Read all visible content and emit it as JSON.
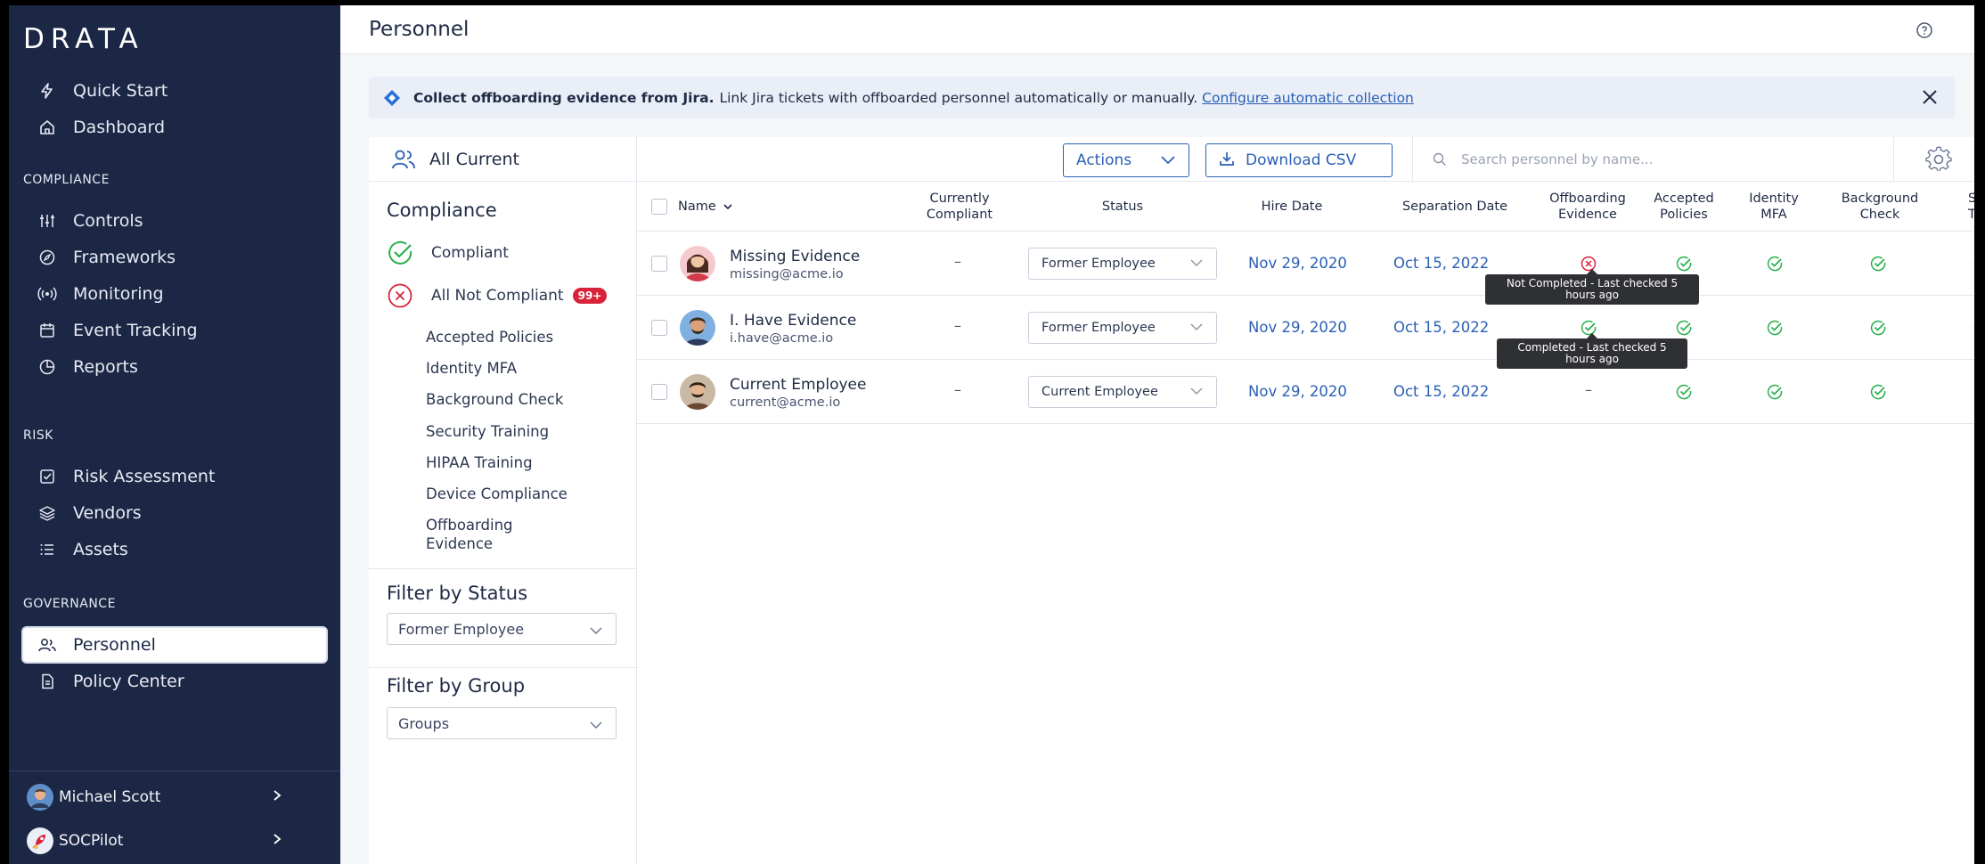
{
  "app": {
    "logo": "DRATA"
  },
  "sidebar": {
    "top_items": [
      {
        "label": "Quick Start",
        "icon": "bolt-icon"
      },
      {
        "label": "Dashboard",
        "icon": "home-icon"
      }
    ],
    "compliance_label": "COMPLIANCE",
    "compliance_items": [
      {
        "label": "Controls",
        "icon": "sliders-icon"
      },
      {
        "label": "Frameworks",
        "icon": "compass-icon"
      },
      {
        "label": "Monitoring",
        "icon": "broadcast-icon"
      },
      {
        "label": "Event Tracking",
        "icon": "calendar-icon"
      },
      {
        "label": "Reports",
        "icon": "pie-chart-icon"
      }
    ],
    "risk_label": "RISK",
    "risk_items": [
      {
        "label": "Risk Assessment",
        "icon": "checkbox-icon"
      },
      {
        "label": "Vendors",
        "icon": "layers-icon"
      },
      {
        "label": "Assets",
        "icon": "list-icon"
      }
    ],
    "governance_label": "GOVERNANCE",
    "governance_items": [
      {
        "label": "Personnel",
        "icon": "people-icon",
        "active": true
      },
      {
        "label": "Policy Center",
        "icon": "document-icon"
      }
    ],
    "user": {
      "name": "Michael Scott"
    },
    "org": {
      "name": "SOCPilot"
    }
  },
  "header": {
    "title": "Personnel"
  },
  "banner": {
    "bold": "Collect offboarding evidence from Jira.",
    "text": "Link Jira tickets with offboarded personnel automatically or manually.",
    "link": "Configure automatic collection"
  },
  "filters": {
    "all_current": "All Current",
    "compliance_title": "Compliance",
    "compliant": "Compliant",
    "not_compliant": "All Not Compliant",
    "not_compliant_badge": "99+",
    "sub_items": [
      "Accepted Policies",
      "Identity MFA",
      "Background Check",
      "Security Training",
      "HIPAA Training",
      "Device Compliance",
      "Offboarding Evidence"
    ],
    "status_title": "Filter by Status",
    "status_value": "Former Employee",
    "group_title": "Filter by Group",
    "group_value": "Groups"
  },
  "toolbar": {
    "actions": "Actions",
    "download": "Download CSV",
    "search_placeholder": "Search personnel by name..."
  },
  "table": {
    "headers": {
      "name": "Name",
      "compliant_1": "Currently",
      "compliant_2": "Compliant",
      "status": "Status",
      "hire": "Hire Date",
      "separation": "Separation Date",
      "offb_1": "Offboarding",
      "offb_2": "Evidence",
      "acc_1": "Accepted",
      "acc_2": "Policies",
      "mfa_1": "Identity",
      "mfa_2": "MFA",
      "bg_1": "Background",
      "bg_2": "Check",
      "st_1": "Se",
      "st_2": "Tr"
    },
    "rows": [
      {
        "name": "Missing Evidence",
        "email": "missing@acme.io",
        "compliant": "–",
        "status": "Former Employee",
        "hire": "Nov 29, 2020",
        "separation": "Oct 15, 2022"
      },
      {
        "name": "I. Have Evidence",
        "email": "i.have@acme.io",
        "compliant": "–",
        "status": "Former Employee",
        "hire": "Nov 29, 2020",
        "separation": "Oct 15, 2022"
      },
      {
        "name": "Current Employee",
        "email": "current@acme.io",
        "compliant": "–",
        "status": "Current Employee",
        "hire": "Nov 29, 2020",
        "separation": "Oct 15, 2022",
        "offboarding": "–"
      }
    ],
    "tooltips": {
      "row1_1": "Not Completed - Last checked 5",
      "row1_2": "hours ago",
      "row2_1": "Completed - Last checked 5",
      "row2_2": "hours ago"
    }
  },
  "colors": {
    "sidebar": "#1c2745",
    "accent": "#2a5fb5",
    "success": "#27b04d",
    "error": "#d8233b"
  }
}
